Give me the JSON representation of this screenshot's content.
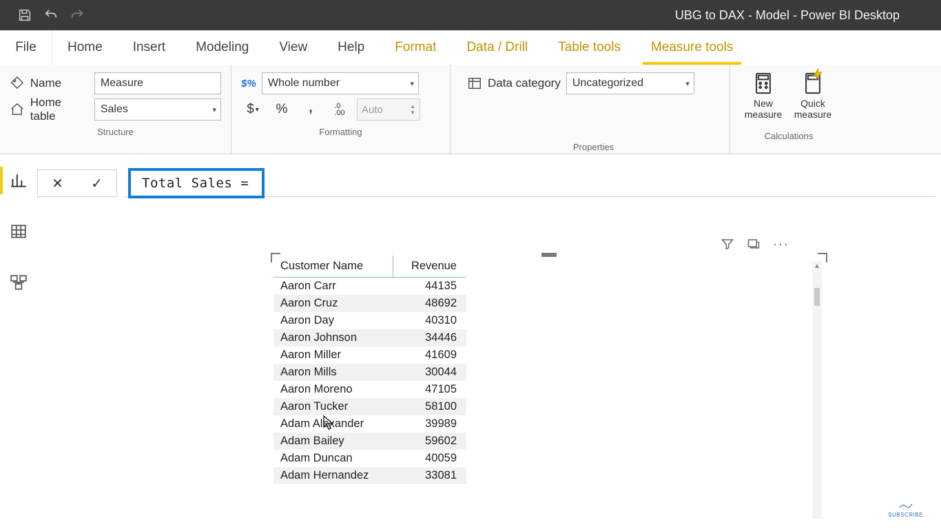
{
  "titlebar": {
    "title": "UBG to DAX - Model - Power BI Desktop"
  },
  "tabs": {
    "file": "File",
    "items": [
      {
        "label": "Home",
        "ctx": false
      },
      {
        "label": "Insert",
        "ctx": false
      },
      {
        "label": "Modeling",
        "ctx": false
      },
      {
        "label": "View",
        "ctx": false
      },
      {
        "label": "Help",
        "ctx": false
      },
      {
        "label": "Format",
        "ctx": true
      },
      {
        "label": "Data / Drill",
        "ctx": true
      },
      {
        "label": "Table tools",
        "ctx": true
      },
      {
        "label": "Measure tools",
        "ctx": true,
        "active": true
      }
    ]
  },
  "ribbon": {
    "structure": {
      "group_label": "Structure",
      "name_label": "Name",
      "name_value": "Measure",
      "home_label": "Home table",
      "home_value": "Sales"
    },
    "formatting": {
      "group_label": "Formatting",
      "format_value": "Whole number",
      "currency": "$",
      "percent": "%",
      "comma": ",",
      "decimals_icon": ".00",
      "auto": "Auto"
    },
    "properties": {
      "group_label": "Properties",
      "datacat_label": "Data category",
      "datacat_value": "Uncategorized"
    },
    "calculations": {
      "group_label": "Calculations",
      "new_measure": "New\nmeasure",
      "quick_measure": "Quick\nmeasure"
    }
  },
  "formula": {
    "dax": "Total Sales ="
  },
  "visual": {
    "col1": "Customer Name",
    "col2": "Revenue",
    "rows": [
      {
        "name": "Aaron Carr",
        "rev": "44135"
      },
      {
        "name": "Aaron Cruz",
        "rev": "48692"
      },
      {
        "name": "Aaron Day",
        "rev": "40310"
      },
      {
        "name": "Aaron Johnson",
        "rev": "34446"
      },
      {
        "name": "Aaron Miller",
        "rev": "41609"
      },
      {
        "name": "Aaron Mills",
        "rev": "30044"
      },
      {
        "name": "Aaron Moreno",
        "rev": "47105"
      },
      {
        "name": "Aaron Tucker",
        "rev": "58100"
      },
      {
        "name": "Adam Alexander",
        "rev": "39989"
      },
      {
        "name": "Adam Bailey",
        "rev": "59602"
      },
      {
        "name": "Adam Duncan",
        "rev": "40059"
      },
      {
        "name": "Adam Hernandez",
        "rev": "33081"
      }
    ]
  },
  "footer": {
    "subscribe": "SUBSCRIBE"
  }
}
